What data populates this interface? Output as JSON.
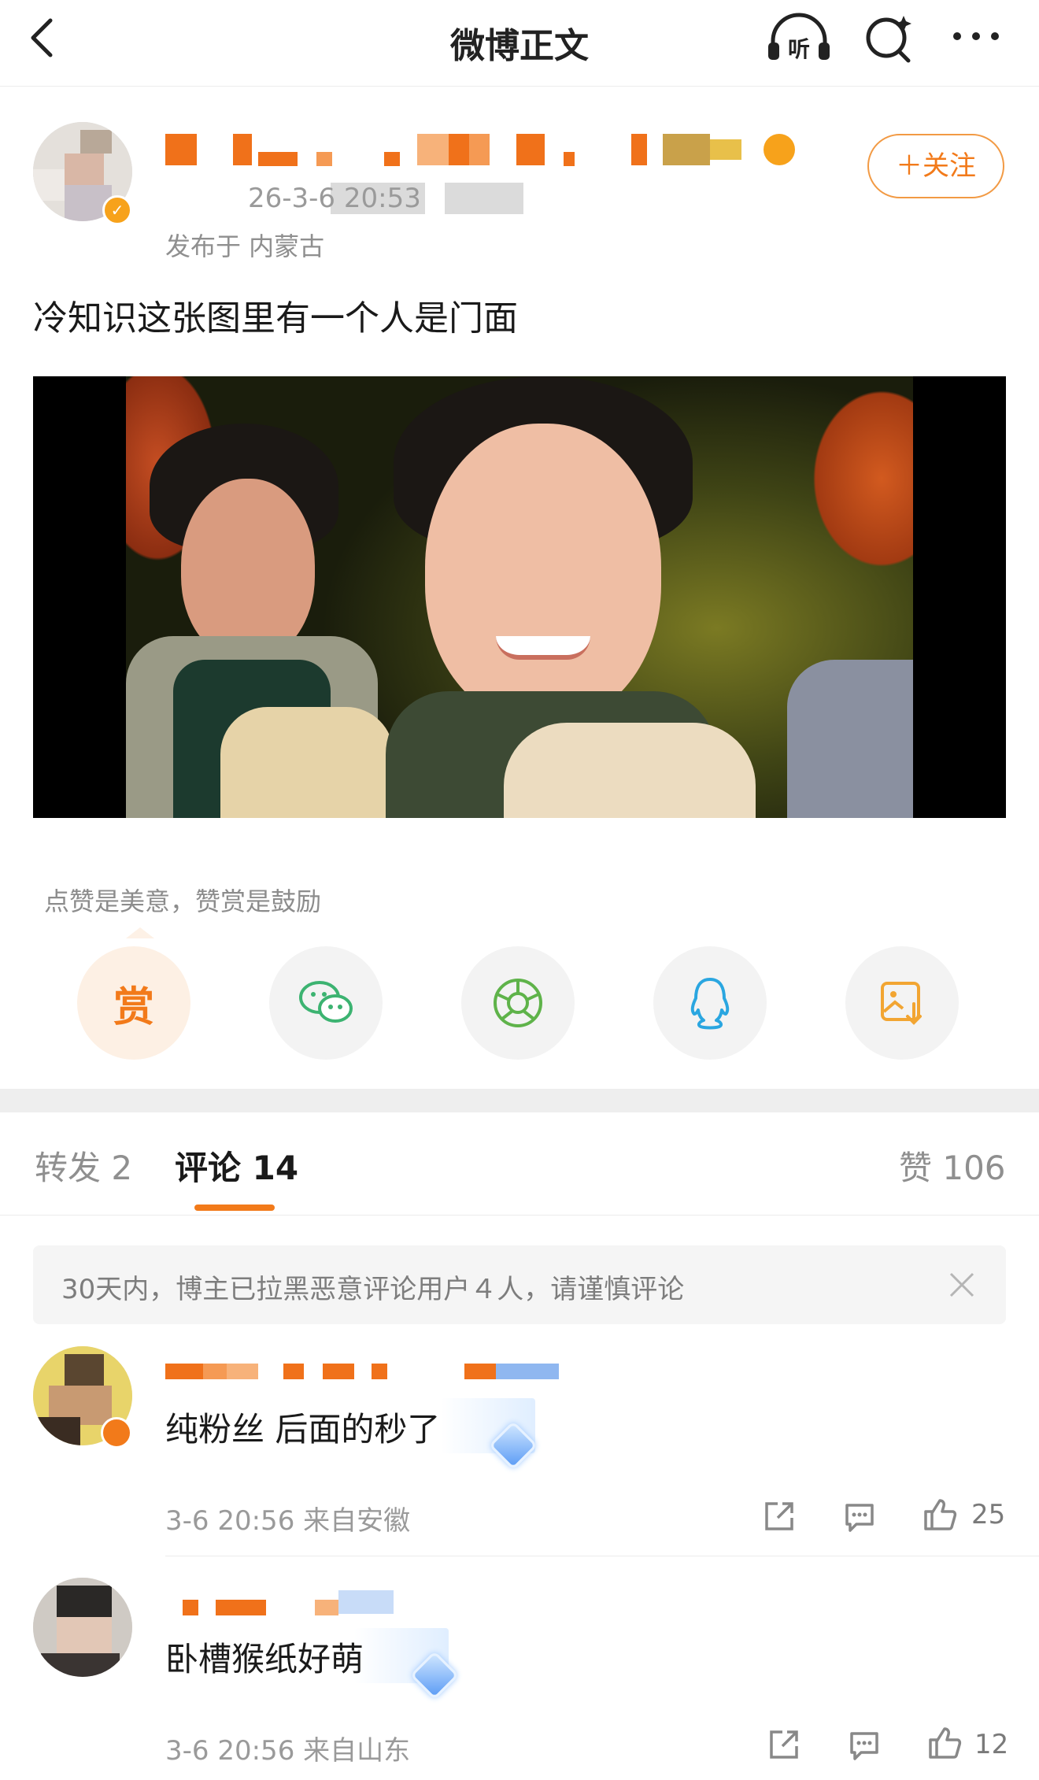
{
  "nav": {
    "title": "微博正文",
    "listen_label": "听"
  },
  "author": {
    "meta": "26-3-6 20:53",
    "location": "发布于 内蒙古",
    "follow_label": "＋关注"
  },
  "post": {
    "text": "冷知识这张图里有一个人是门面"
  },
  "reward_tip": "点赞是美意，赞赏是鼓励",
  "share": {
    "reward_label": "赏"
  },
  "tabs": {
    "repost": "转发 2",
    "comment": "评论 14",
    "like": "赞 106"
  },
  "notice": {
    "text": "30天内，博主已拉黑恶意评论用户４人，请谨慎评论"
  },
  "comments": [
    {
      "text": "纯粉丝 后面的秒了",
      "time": "3-6 20:56 来自安徽",
      "likes": "25"
    },
    {
      "text": "卧槽猴纸好萌",
      "time": "3-6 20:56 来自山东",
      "likes": "12"
    }
  ],
  "colors": {
    "accent": "#f27a1a",
    "wechat": "#3cb371",
    "moments": "#5fb34a",
    "qq": "#2aa6e0",
    "save": "#f2a532"
  }
}
